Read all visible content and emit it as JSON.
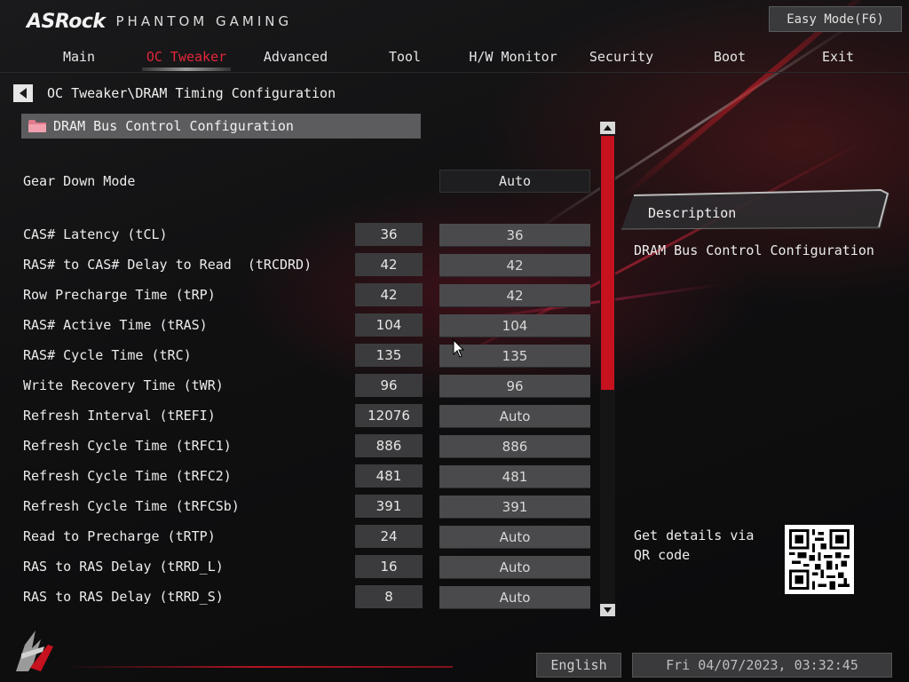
{
  "header": {
    "brand": "ASRock",
    "brand_sub": "PHANTOM GAMING",
    "easy_mode": "Easy Mode(F6)"
  },
  "nav": {
    "active": "OC Tweaker",
    "items": [
      {
        "label": "Main"
      },
      {
        "label": "OC Tweaker"
      },
      {
        "label": "Advanced"
      },
      {
        "label": "Tool"
      },
      {
        "label": "H/W Monitor"
      },
      {
        "label": "Security"
      },
      {
        "label": "Boot"
      },
      {
        "label": "Exit"
      }
    ]
  },
  "breadcrumb": "OC Tweaker\\DRAM Timing Configuration",
  "section": {
    "label": "DRAM Bus Control Configuration",
    "icon": "folder-icon"
  },
  "gear_down": {
    "label": "Gear Down Mode",
    "value": "Auto"
  },
  "rows": [
    {
      "label": "CAS# Latency (tCL)",
      "current": "36",
      "setting": "36"
    },
    {
      "label": "RAS# to CAS# Delay to Read  (tRCDRD)",
      "current": "42",
      "setting": "42"
    },
    {
      "label": "Row Precharge Time (tRP)",
      "current": "42",
      "setting": "42"
    },
    {
      "label": "RAS# Active Time (tRAS)",
      "current": "104",
      "setting": "104"
    },
    {
      "label": "RAS# Cycle Time (tRC)",
      "current": "135",
      "setting": "135"
    },
    {
      "label": "Write Recovery Time (tWR)",
      "current": "96",
      "setting": "96"
    },
    {
      "label": "Refresh Interval (tREFI)",
      "current": "12076",
      "setting": "Auto"
    },
    {
      "label": "Refresh Cycle Time (tRFC1)",
      "current": "886",
      "setting": "886"
    },
    {
      "label": "Refresh Cycle Time (tRFC2)",
      "current": "481",
      "setting": "481"
    },
    {
      "label": "Refresh Cycle Time (tRFCSb)",
      "current": "391",
      "setting": "391"
    },
    {
      "label": "Read to Precharge (tRTP)",
      "current": "24",
      "setting": "Auto"
    },
    {
      "label": "RAS to RAS Delay (tRRD_L)",
      "current": "16",
      "setting": "Auto"
    },
    {
      "label": "RAS to RAS Delay (tRRD_S)",
      "current": "8",
      "setting": "Auto"
    }
  ],
  "description": {
    "title": "Description",
    "text": "DRAM Bus Control Configuration",
    "qr_text": "Get details via QR code"
  },
  "footer": {
    "language": "English",
    "datetime": "Fri 04/07/2023, 03:32:45"
  },
  "colors": {
    "accent": "#c6111f",
    "active_tab": "#e3263a"
  }
}
